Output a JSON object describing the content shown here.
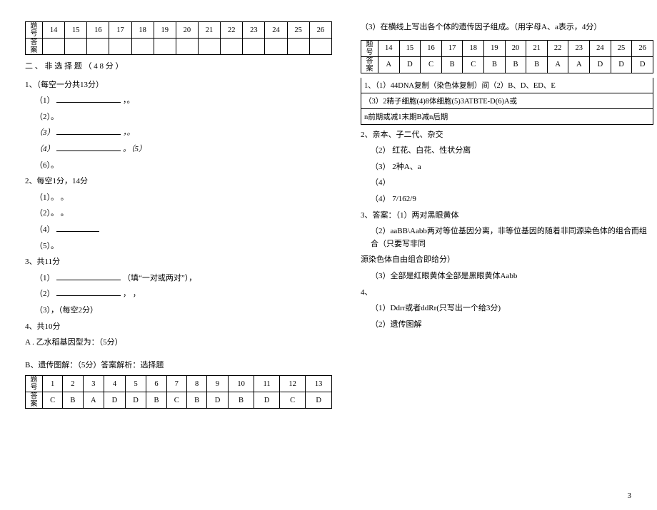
{
  "leftTable": {
    "rowLabels": [
      "题号",
      "答案"
    ],
    "cols": [
      "14",
      "15",
      "16",
      "17",
      "18",
      "19",
      "20",
      "21",
      "22",
      "23",
      "24",
      "25",
      "26"
    ]
  },
  "sectionHeading": "二 、 非 选 择 题 （ 4 8 分 ）",
  "leftLines": {
    "q1_title": "1、（每空一分共13分）",
    "q1_1": "（1）",
    "q1_1_tail": "，。",
    "q1_2": "（2）。",
    "q1_3": "（3）",
    "q1_3_tail": "，。",
    "q1_4": "（4）",
    "q1_4_tail": "。（5）",
    "q1_6": "（6）。",
    "q2_title": "2、每空1分，14分",
    "q2_1": "（1）。    。",
    "q2_2": "（2）。    。",
    "q2_4": "（4）",
    "q2_5": "（5）。",
    "q3_title": "3、共11分",
    "q3_1a": "（1）",
    "q3_1b": "（填“一对或两对”），",
    "q3_2": "（2）",
    "q3_2_tail": "，  ，",
    "q3_3": "（3），（每空2分）",
    "q4_title": "4、共10分",
    "q4_a": "A . 乙水稻基因型为：（5分）",
    "q4_b": "B、遗传图解：（5分）答案解析：选择题"
  },
  "bottomTable": {
    "rowLabels": [
      "题号",
      "答案"
    ],
    "cols": [
      "1",
      "2",
      "3",
      "4",
      "5",
      "6",
      "7",
      "8",
      "9",
      "10",
      "11",
      "12",
      "13"
    ],
    "answers": [
      "C",
      "B",
      "A",
      "D",
      "D",
      "B",
      "C",
      "B",
      "D",
      "B",
      "D",
      "C",
      "D"
    ]
  },
  "rightTable": {
    "rowLabels": [
      "题号",
      "答案"
    ],
    "cols": [
      "14",
      "15",
      "16",
      "17",
      "18",
      "19",
      "20",
      "21",
      "22",
      "23",
      "24",
      "25",
      "26"
    ],
    "answers": [
      "A",
      "D",
      "C",
      "B",
      "C",
      "B",
      "B",
      "B",
      "A",
      "A",
      "D",
      "D",
      "D"
    ]
  },
  "rightTop": "（3）在横线上写出各个体的遗传因子组成。（用字母A、a表示，4分）",
  "boxedRows": [
    "1、（1）44DNA复制（染色体复制）间（2）B、D、ED、E",
    "（3）2精子细胞(4)8体细胞(5)3ATBTE-D(6)A或",
    "n前期或减1末期B减n后期"
  ],
  "rightLines": {
    "r2a": "2、亲本、子二代、杂交",
    "r2b": "（2） 红花、白花、性状分离",
    "r2c": "（3） 2种A、a",
    "r2d": "（4）",
    "r2e": "（4） 7/162/9",
    "r3a": "3、答案：（1）两对黑眼黄体",
    "r3b": "（2）aaBB\\Aabb两对等位基因分离，非等位基因的随着非同源染色体的组合而组合（只要写非同",
    "r3c": "源染色体自由组合即给分）",
    "r3d": "（3）全部是红眼黄体全部是黑眼黄体Aabb",
    "r4a": "4、",
    "r4b": "（1）Ddrr或者ddRr(只写出一个给3分)",
    "r4c": "（2）遗传图解"
  },
  "pageNum": "3"
}
